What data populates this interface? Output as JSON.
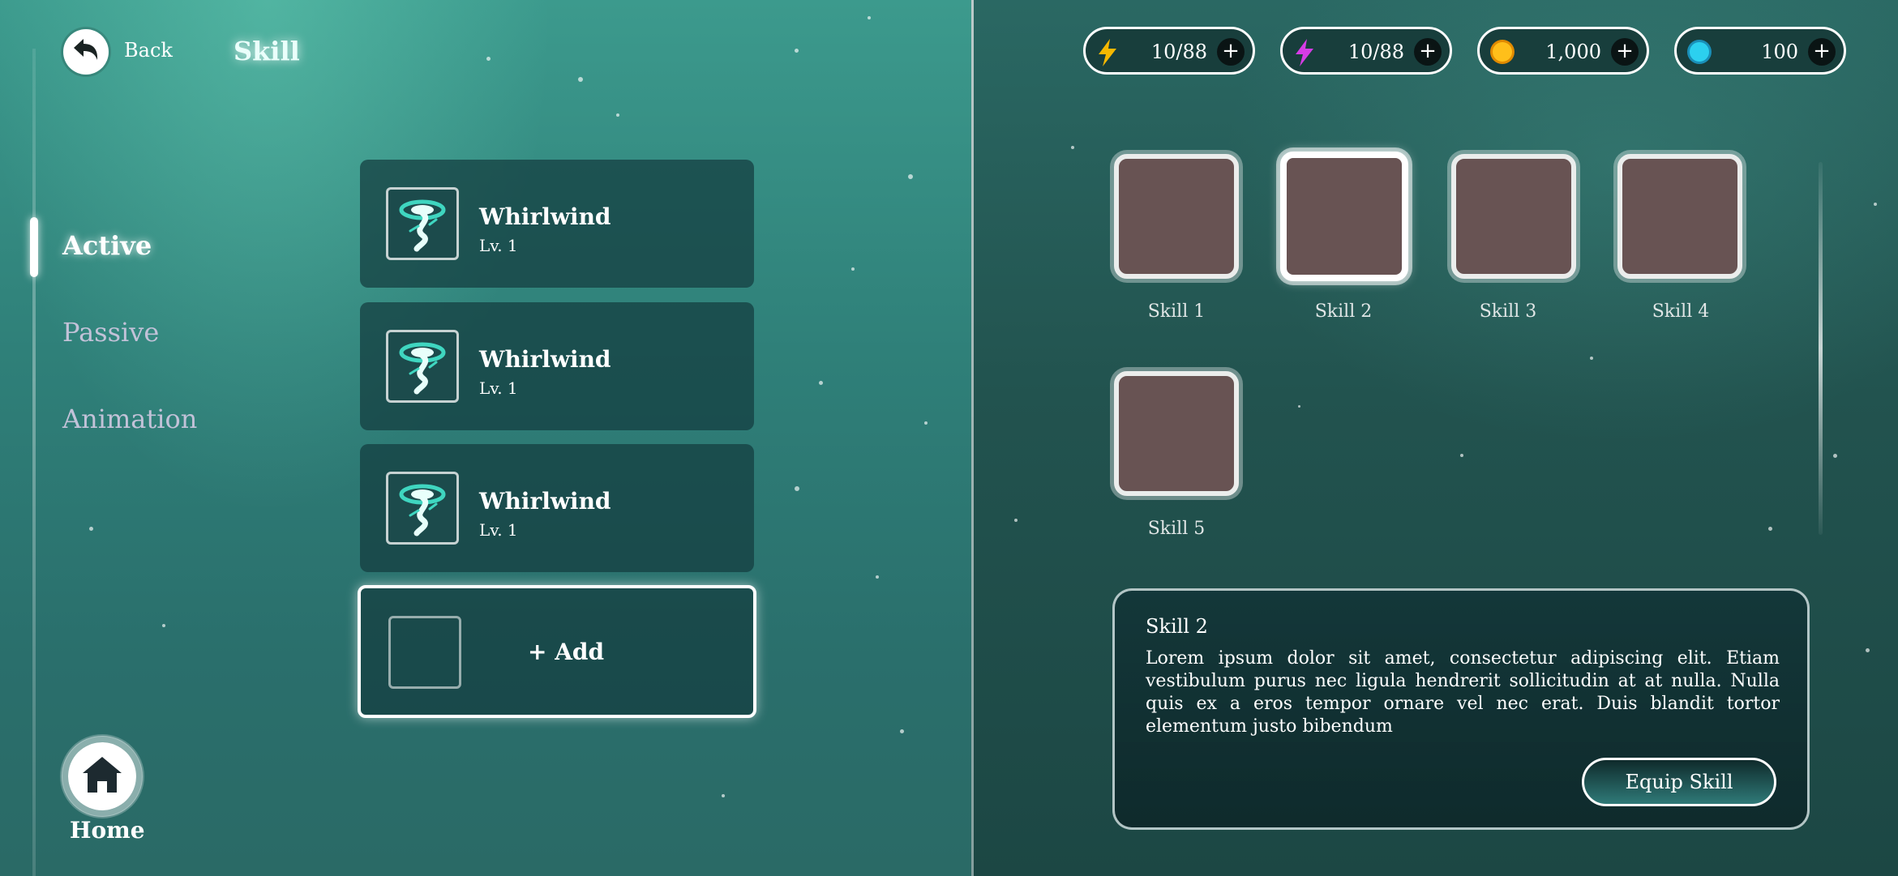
{
  "header": {
    "back_label": "Back",
    "title": "Skill"
  },
  "nav": {
    "items": [
      {
        "label": "Active",
        "active": true
      },
      {
        "label": "Passive",
        "active": false
      },
      {
        "label": "Animation",
        "active": false
      }
    ],
    "home_label": "Home"
  },
  "skill_list": {
    "items": [
      {
        "name": "Whirlwind",
        "level": "Lv. 1",
        "icon": "whirlwind-icon"
      },
      {
        "name": "Whirlwind",
        "level": "Lv. 1",
        "icon": "whirlwind-icon"
      },
      {
        "name": "Whirlwind",
        "level": "Lv. 1",
        "icon": "whirlwind-icon"
      }
    ],
    "add_label": "+ Add"
  },
  "resources": [
    {
      "icon": "lightning-icon",
      "color": "#f5b800",
      "value": "10/88",
      "plus": "+"
    },
    {
      "icon": "lightning-icon",
      "color": "#d63ce6",
      "value": "10/88",
      "plus": "+"
    },
    {
      "icon": "gold-coin-icon",
      "color": "#ffb400",
      "value": "1,000",
      "plus": "+"
    },
    {
      "icon": "gem-icon",
      "color": "#25c6e8",
      "value": "100",
      "plus": "+"
    }
  ],
  "slots": {
    "items": [
      {
        "label": "Skill 1",
        "selected": false
      },
      {
        "label": "Skill 2",
        "selected": true
      },
      {
        "label": "Skill 3",
        "selected": false
      },
      {
        "label": "Skill 4",
        "selected": false
      },
      {
        "label": "Skill 5",
        "selected": false
      }
    ]
  },
  "detail": {
    "title": "Skill 2",
    "description": "Lorem ipsum dolor sit amet, consectetur adipiscing elit. Etiam vestibulum purus nec ligula hendrerit sollicitudin at at nulla. Nulla quis ex a eros tempor ornare vel nec erat. Duis blandit tortor elementum justo bibendum",
    "equip_label": "Equip Skill"
  },
  "colors": {
    "slot_fill": "#685353",
    "accent_teal": "#37c9b5"
  }
}
